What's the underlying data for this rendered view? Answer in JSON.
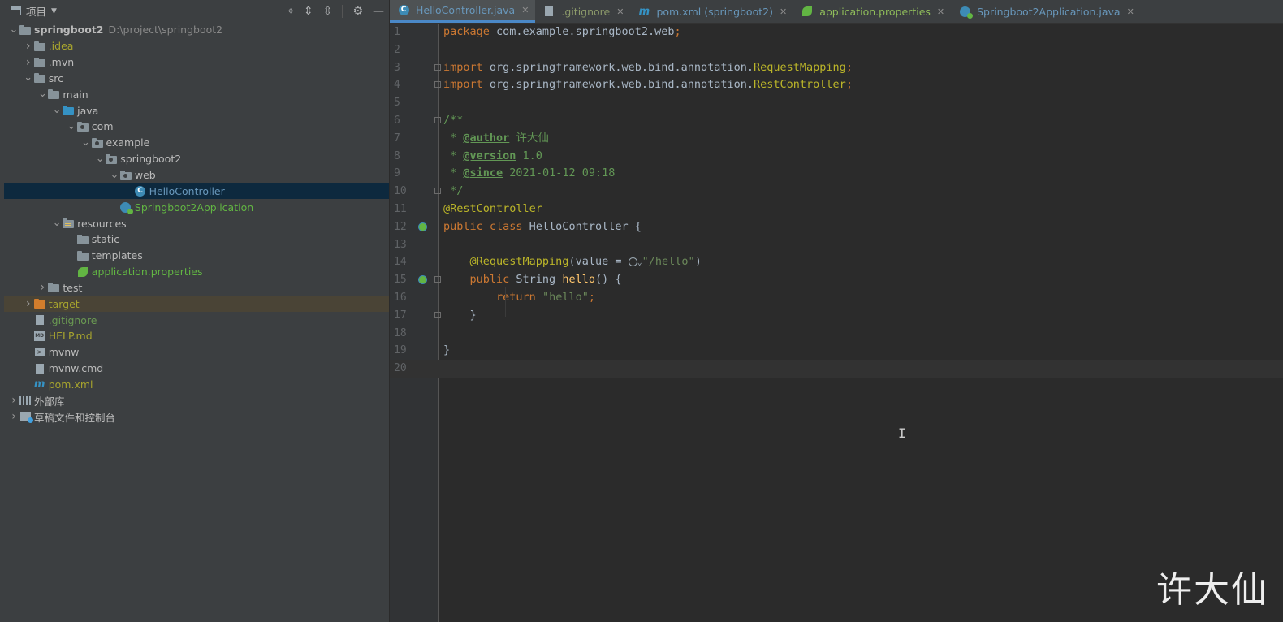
{
  "project_panel": {
    "title": "项目",
    "tree": [
      {
        "label": "springboot2",
        "path": "D:\\project\\springboot2",
        "depth": 0,
        "expanded": true,
        "icon": "module-folder-icon",
        "color": "default",
        "bold": true
      },
      {
        "label": ".idea",
        "depth": 1,
        "expanded": false,
        "icon": "folder-icon",
        "color": "olive"
      },
      {
        "label": ".mvn",
        "depth": 1,
        "expanded": false,
        "icon": "folder-icon",
        "color": "default"
      },
      {
        "label": "src",
        "depth": 1,
        "expanded": true,
        "icon": "folder-icon",
        "color": "default"
      },
      {
        "label": "main",
        "depth": 2,
        "expanded": true,
        "icon": "folder-icon",
        "color": "default"
      },
      {
        "label": "java",
        "depth": 3,
        "expanded": true,
        "icon": "source-folder-icon",
        "color": "default"
      },
      {
        "label": "com",
        "depth": 4,
        "expanded": true,
        "icon": "package-icon",
        "color": "default"
      },
      {
        "label": "example",
        "depth": 5,
        "expanded": true,
        "icon": "package-icon",
        "color": "default"
      },
      {
        "label": "springboot2",
        "depth": 6,
        "expanded": true,
        "icon": "package-icon",
        "color": "default"
      },
      {
        "label": "web",
        "depth": 7,
        "expanded": true,
        "icon": "package-icon",
        "color": "default"
      },
      {
        "label": "HelloController",
        "depth": 8,
        "icon": "java-class-icon",
        "color": "blue",
        "selected": true
      },
      {
        "label": "Springboot2Application",
        "depth": 7,
        "icon": "spring-boot-class-icon",
        "color": "green"
      },
      {
        "label": "resources",
        "depth": 3,
        "expanded": true,
        "icon": "resources-folder-icon",
        "color": "default"
      },
      {
        "label": "static",
        "depth": 4,
        "icon": "folder-icon",
        "color": "default"
      },
      {
        "label": "templates",
        "depth": 4,
        "icon": "folder-icon",
        "color": "default"
      },
      {
        "label": "application.properties",
        "depth": 4,
        "icon": "spring-properties-icon",
        "color": "green"
      },
      {
        "label": "test",
        "depth": 2,
        "expanded": false,
        "icon": "folder-icon",
        "color": "default"
      },
      {
        "label": "target",
        "depth": 1,
        "expanded": false,
        "icon": "excluded-folder-icon",
        "color": "olive",
        "highlight": true
      },
      {
        "label": ".gitignore",
        "depth": 1,
        "icon": "gitignore-file-icon",
        "color": "gitignore"
      },
      {
        "label": "HELP.md",
        "depth": 1,
        "icon": "markdown-file-icon",
        "color": "olive"
      },
      {
        "label": "mvnw",
        "depth": 1,
        "icon": "shell-script-icon",
        "color": "default"
      },
      {
        "label": "mvnw.cmd",
        "depth": 1,
        "icon": "text-file-icon",
        "color": "default"
      },
      {
        "label": "pom.xml",
        "depth": 1,
        "icon": "maven-icon",
        "color": "olive"
      },
      {
        "label": "外部库",
        "depth": 0,
        "expanded": false,
        "icon": "library-icon",
        "color": "default"
      },
      {
        "label": "草稿文件和控制台",
        "depth": 0,
        "expanded": false,
        "icon": "scratch-icon",
        "color": "default"
      }
    ]
  },
  "editor_tabs": [
    {
      "label": "HelloController.java",
      "icon": "java-class-icon",
      "active": true
    },
    {
      "label": ".gitignore",
      "icon": "gitignore-file-icon"
    },
    {
      "label": "pom.xml (springboot2)",
      "icon": "maven-icon"
    },
    {
      "label": "application.properties",
      "icon": "spring-properties-icon"
    },
    {
      "label": "Springboot2Application.java",
      "icon": "spring-boot-class-icon"
    }
  ],
  "code": {
    "current_line": 20,
    "lines": [
      {
        "n": "1",
        "t": [
          [
            "kw",
            "package "
          ],
          [
            "p",
            "com.example.springboot2.web"
          ],
          [
            "kw",
            ";"
          ]
        ]
      },
      {
        "n": "2",
        "t": []
      },
      {
        "n": "3",
        "fold": true,
        "t": [
          [
            "kw",
            "import "
          ],
          [
            "p",
            "org.springframework.web.bind.annotation."
          ],
          [
            "annclass",
            "RequestMapping"
          ],
          [
            "kw",
            ";"
          ]
        ]
      },
      {
        "n": "4",
        "fold": true,
        "t": [
          [
            "kw",
            "import "
          ],
          [
            "p",
            "org.springframework.web.bind.annotation."
          ],
          [
            "annclass",
            "RestController"
          ],
          [
            "kw",
            ";"
          ]
        ]
      },
      {
        "n": "5",
        "t": []
      },
      {
        "n": "6",
        "fold": true,
        "t": [
          [
            "doc",
            "/**"
          ]
        ]
      },
      {
        "n": "7",
        "t": [
          [
            "doc",
            " * "
          ],
          [
            "doctag",
            "@author"
          ],
          [
            "doc",
            " 许大仙"
          ]
        ]
      },
      {
        "n": "8",
        "t": [
          [
            "doc",
            " * "
          ],
          [
            "doctag",
            "@version"
          ],
          [
            "doc",
            " 1.0"
          ]
        ]
      },
      {
        "n": "9",
        "t": [
          [
            "doc",
            " * "
          ],
          [
            "doctag",
            "@since"
          ],
          [
            "doc",
            " 2021-01-12 09:18"
          ]
        ]
      },
      {
        "n": "10",
        "fold": true,
        "t": [
          [
            "doc",
            " */"
          ]
        ]
      },
      {
        "n": "11",
        "t": [
          [
            "ann",
            "@RestController"
          ]
        ]
      },
      {
        "n": "12",
        "bean": true,
        "t": [
          [
            "kw",
            "public class "
          ],
          [
            "p",
            "HelloController {"
          ]
        ]
      },
      {
        "n": "13",
        "t": []
      },
      {
        "n": "14",
        "t": [
          [
            "p",
            "    "
          ],
          [
            "ann",
            "@RequestMapping"
          ],
          [
            "p",
            "(value = "
          ],
          [
            "globe",
            ""
          ],
          [
            "str",
            "\""
          ],
          [
            "url",
            "/hello"
          ],
          [
            "str",
            "\""
          ],
          [
            "p",
            ")"
          ]
        ]
      },
      {
        "n": "15",
        "bean": true,
        "fold": true,
        "t": [
          [
            "p",
            "    "
          ],
          [
            "kw",
            "public "
          ],
          [
            "p",
            "String "
          ],
          [
            "fn",
            "hello"
          ],
          [
            "p",
            "() {"
          ]
        ]
      },
      {
        "n": "16",
        "t": [
          [
            "p",
            "        "
          ],
          [
            "kw",
            "return "
          ],
          [
            "str",
            "\"hello\""
          ],
          [
            "kw",
            ";"
          ]
        ]
      },
      {
        "n": "17",
        "fold": true,
        "t": [
          [
            "p",
            "    }"
          ]
        ]
      },
      {
        "n": "18",
        "t": []
      },
      {
        "n": "19",
        "t": [
          [
            "p",
            "}"
          ]
        ]
      },
      {
        "n": "20",
        "t": []
      }
    ]
  },
  "watermark": "许大仙",
  "colors": {
    "keyword": "#cc7832",
    "annotation": "#bbb529",
    "string": "#6a8759",
    "doc": "#629755",
    "selection": "#0d293e",
    "accent": "#4a88c7"
  }
}
